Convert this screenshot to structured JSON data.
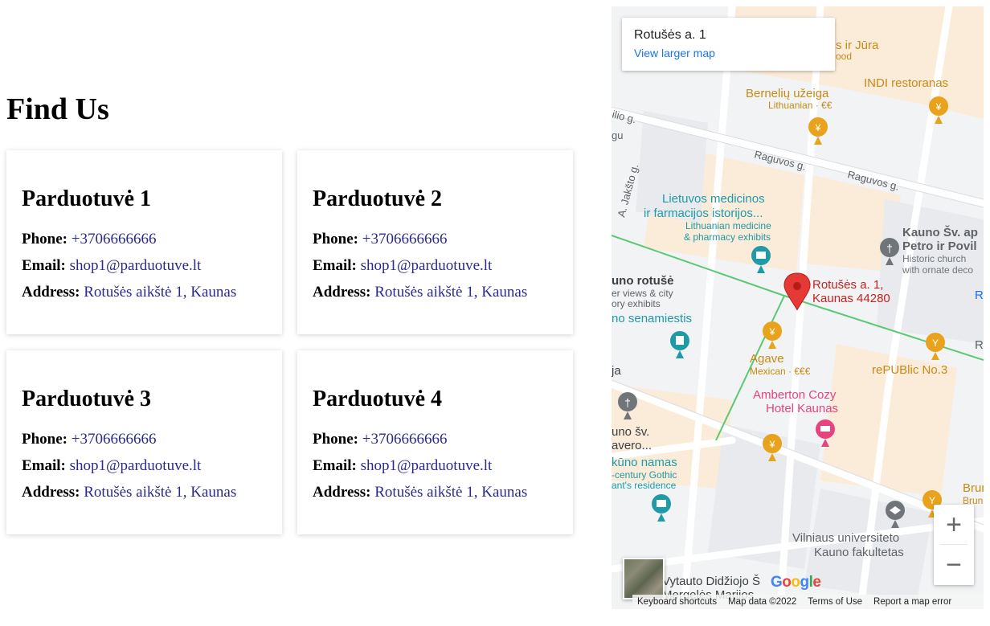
{
  "page": {
    "title": "Find Us"
  },
  "stores": [
    {
      "name": "Parduotuvė 1",
      "phone_label": "Phone:",
      "phone": "+3706666666",
      "email_label": "Email:",
      "email": "shop1@parduotuve.lt",
      "address_label": "Address:",
      "address": "Rotušės aikštė 1, Kaunas"
    },
    {
      "name": "Parduotuvė 2",
      "phone_label": "Phone:",
      "phone": "+3706666666",
      "email_label": "Email:",
      "email": "shop1@parduotuve.lt",
      "address_label": "Address:",
      "address": "Rotušės aikštė 1, Kaunas"
    },
    {
      "name": "Parduotuvė 3",
      "phone_label": "Phone:",
      "phone": "+3706666666",
      "email_label": "Email:",
      "email": "shop1@parduotuve.lt",
      "address_label": "Address:",
      "address": "Rotušės aikštė 1, Kaunas"
    },
    {
      "name": "Parduotuvė 4",
      "phone_label": "Phone:",
      "phone": "+3706666666",
      "email_label": "Email:",
      "email": "shop1@parduotuve.lt",
      "address_label": "Address:",
      "address": "Rotušės aikštė 1, Kaunas"
    }
  ],
  "map": {
    "place_title": "Rotušės a. 1",
    "view_larger": "View larger map",
    "marker_label_1": "Rotušės a. 1,",
    "marker_label_2": "Kaunas 44280",
    "labels": {
      "food_top": "s ir Jūra",
      "food_top_sub": "ood",
      "berneliu": "Bernelių užeiga",
      "berneliu_sub": "Lithuanian · €€",
      "indi": "INDI restoranas",
      "raguvos1": "Raguvos g.",
      "raguvos2": "Raguvos g.",
      "jaksto": "A. Jakšto g.",
      "ilio": "ilio g.",
      "gu": "gu",
      "museum1": "Lietuvos medicinos",
      "museum2": "ir farmacijos istorijos...",
      "museum3": "Lithuanian medicine",
      "museum4": "& pharmacy exhibits",
      "church1": "Kauno Šv. ap",
      "church2": "Petro ir Povil",
      "church3": "Historic church",
      "church4": "with ornate deco",
      "rotuse1": "uno rotušė",
      "rotuse2": "er views & city",
      "rotuse3": "ory exhibits",
      "senamiestis": "no senamiestis",
      "agave": "Agave",
      "agave_sub": "Mexican · €€€",
      "republic": "rePUBlic No.3",
      "amberton1": "Amberton Cozy",
      "amberton2": "Hotel Kaunas",
      "ja": "ja",
      "sv1": "uno šv.",
      "sv2": "avero...",
      "namas1": "kūno namas",
      "namas2": "-century Gothic",
      "namas3": "ant's residence",
      "univ1": "Vilniaus universiteto",
      "univ2": "Kauno fakultetas",
      "vdu1": "Vytauto Didžiojo Š",
      "vdu2": "Mergelės Marijos",
      "brun1": "Brun",
      "brun2": "Brunc",
      "r1": "R",
      "r2": "R"
    },
    "zoom_in": "+",
    "zoom_out": "−",
    "google": [
      "G",
      "o",
      "o",
      "g",
      "l",
      "e"
    ],
    "attribution": {
      "shortcuts": "Keyboard shortcuts",
      "data": "Map data ©2022",
      "terms": "Terms of Use",
      "report": "Report a map error"
    },
    "colors": {
      "food": "#e8a21b",
      "museum": "#1e9aa8",
      "hotel": "#e7437f",
      "marker": "#e53935",
      "route": "#5bc873",
      "poi_gray": "#70757a"
    }
  }
}
